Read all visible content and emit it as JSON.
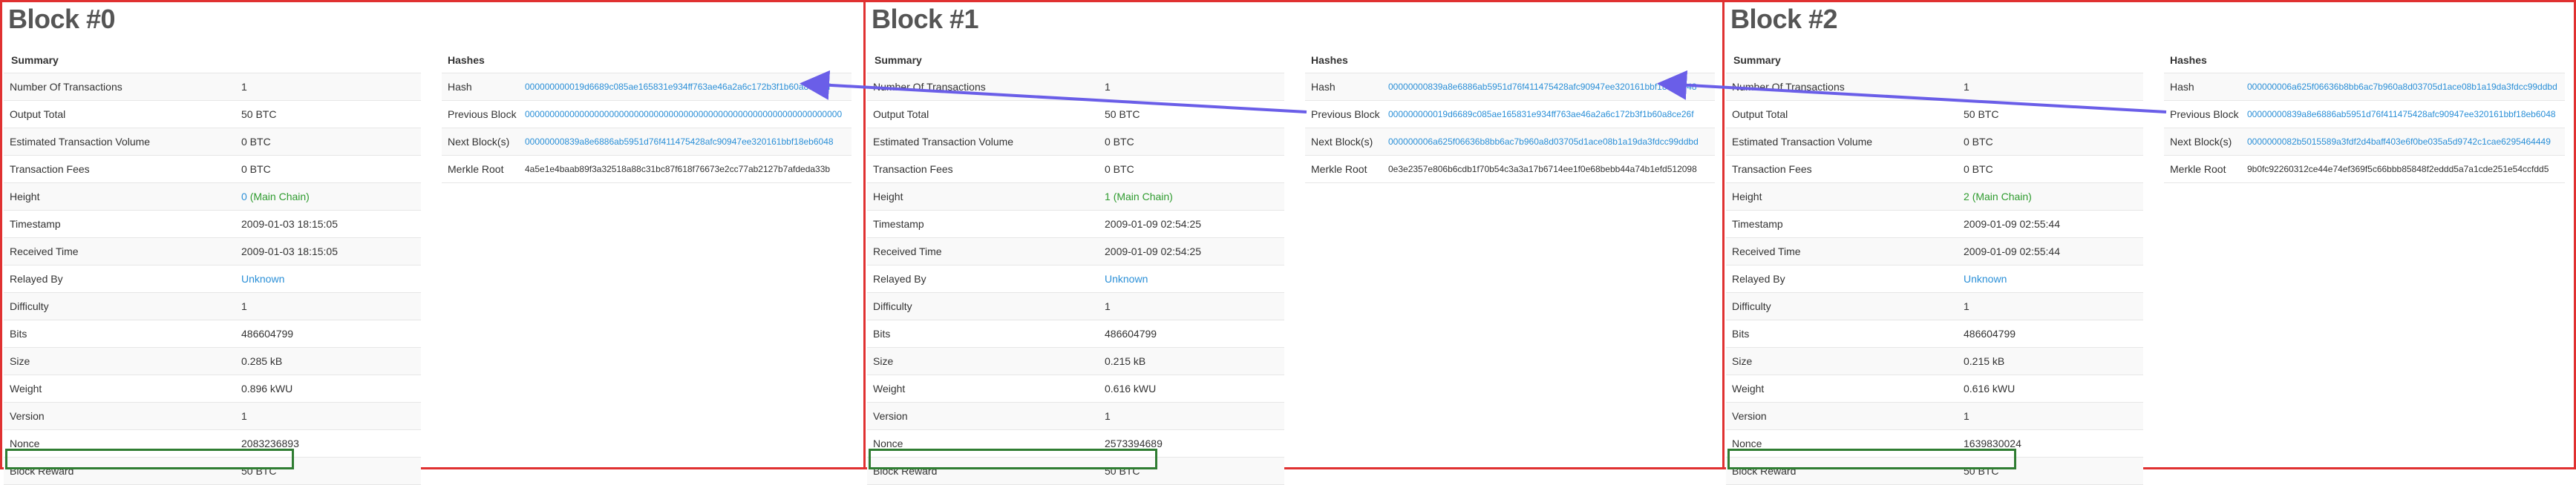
{
  "colors": {
    "panel_border": "#e03131",
    "reward_box": "#2f7d32",
    "arrow": "#6a5ee8",
    "link": "#2a8fd7",
    "chain": "#2e9b2e"
  },
  "summary_labels": {
    "header": "Summary",
    "n_tx": "Number Of Transactions",
    "output_total": "Output Total",
    "est_volume": "Estimated Transaction Volume",
    "fees": "Transaction Fees",
    "height": "Height",
    "timestamp": "Timestamp",
    "received": "Received Time",
    "relayed": "Relayed By",
    "difficulty": "Difficulty",
    "bits": "Bits",
    "size": "Size",
    "weight": "Weight",
    "version": "Version",
    "nonce": "Nonce",
    "reward": "Block Reward"
  },
  "hash_labels": {
    "header": "Hashes",
    "hash": "Hash",
    "prev": "Previous Block",
    "next": "Next Block(s)",
    "merkle": "Merkle Root"
  },
  "blocks": [
    {
      "title": "Block #0",
      "n_tx": "1",
      "output_total": "50 BTC",
      "est_volume": "0 BTC",
      "fees": "0 BTC",
      "height": "0",
      "height_note": "(Main Chain)",
      "timestamp": "2009-01-03 18:15:05",
      "received": "2009-01-03 18:15:05",
      "relayed": "Unknown",
      "difficulty": "1",
      "bits": "486604799",
      "size": "0.285 kB",
      "weight": "0.896 kWU",
      "version": "1",
      "nonce": "2083236893",
      "reward": "50 BTC",
      "hash": "000000000019d6689c085ae165831e934ff763ae46a2a6c172b3f1b60a8ce26f",
      "prev": "0000000000000000000000000000000000000000000000000000000000000000",
      "next": "00000000839a8e6886ab5951d76f411475428afc90947ee320161bbf18eb6048",
      "merkle": "4a5e1e4baab89f3a32518a88c31bc87f618f76673e2cc77ab2127b7afdeda33b"
    },
    {
      "title": "Block #1",
      "n_tx": "1",
      "output_total": "50 BTC",
      "est_volume": "0 BTC",
      "fees": "0 BTC",
      "height": "1",
      "height_note": "(Main Chain)",
      "timestamp": "2009-01-09 02:54:25",
      "received": "2009-01-09 02:54:25",
      "relayed": "Unknown",
      "difficulty": "1",
      "bits": "486604799",
      "size": "0.215 kB",
      "weight": "0.616 kWU",
      "version": "1",
      "nonce": "2573394689",
      "reward": "50 BTC",
      "hash": "00000000839a8e6886ab5951d76f411475428afc90947ee320161bbf18eb6048",
      "prev": "000000000019d6689c085ae165831e934ff763ae46a2a6c172b3f1b60a8ce26f",
      "next": "000000006a625f06636b8bb6ac7b960a8d03705d1ace08b1a19da3fdcc99ddbd",
      "merkle": "0e3e2357e806b6cdb1f70b54c3a3a17b6714ee1f0e68bebb44a74b1efd512098"
    },
    {
      "title": "Block #2",
      "n_tx": "1",
      "output_total": "50 BTC",
      "est_volume": "0 BTC",
      "fees": "0 BTC",
      "height": "2",
      "height_note": "(Main Chain)",
      "timestamp": "2009-01-09 02:55:44",
      "received": "2009-01-09 02:55:44",
      "relayed": "Unknown",
      "difficulty": "1",
      "bits": "486604799",
      "size": "0.215 kB",
      "weight": "0.616 kWU",
      "version": "1",
      "nonce": "1639830024",
      "reward": "50 BTC",
      "hash": "000000006a625f06636b8bb6ac7b960a8d03705d1ace08b1a19da3fdcc99ddbd",
      "prev": "00000000839a8e6886ab5951d76f411475428afc90947ee320161bbf18eb6048",
      "next": "0000000082b5015589a3fdf2d4baff403e6f0be035a5d9742c1cae6295464449",
      "merkle": "9b0fc92260312ce44e74ef369f5c66bbb85848f2eddd5a7a1cde251e54ccfdd5"
    }
  ]
}
